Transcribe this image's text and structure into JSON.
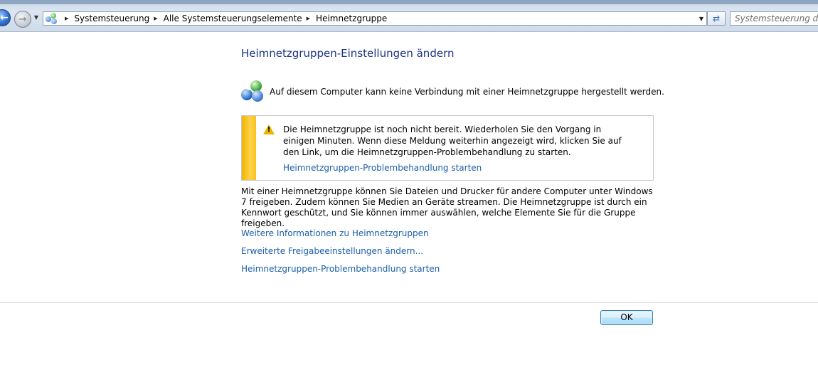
{
  "address_bar": {
    "breadcrumbs": [
      "Systemsteuerung",
      "Alle Systemsteuerungselemente",
      "Heimnetzgruppe"
    ],
    "search_placeholder": "Systemsteuerung durchsuchen"
  },
  "page": {
    "title": "Heimnetzgruppen-Einstellungen ändern",
    "status_message": "Auf diesem Computer kann keine Verbindung mit einer Heimnetzgruppe hergestellt werden."
  },
  "warning": {
    "text": "Die Heimnetzgruppe ist noch nicht bereit. Wiederholen Sie den Vorgang in einigen Minuten. Wenn diese Meldung weiterhin angezeigt wird, klicken Sie auf den Link, um die Heimnetzgruppen-Problembehandlung zu starten.",
    "link": "Heimnetzgruppen-Problembehandlung starten"
  },
  "description": "Mit einer Heimnetzgruppe können Sie Dateien und Drucker für andere Computer unter Windows 7 freigeben. Zudem können Sie Medien an Geräte streamen. Die Heimnetzgruppe ist durch ein Kennwort geschützt, und Sie können immer auswählen, welche Elemente Sie für die Gruppe freigeben.",
  "links": [
    "Weitere Informationen zu Heimnetzgruppen",
    "Erweiterte Freigabeeinstellungen ändern...",
    "Heimnetzgruppen-Problembehandlung starten"
  ],
  "buttons": {
    "ok": "OK"
  },
  "icons": {
    "back": "back-arrow-icon",
    "forward": "forward-arrow-icon",
    "homegroup": "homegroup-icon",
    "warning": "warning-icon",
    "refresh": "refresh-icon"
  },
  "colors": {
    "title": "#1e3287",
    "link": "#1a5fa8",
    "warning_bar": "#f0b400"
  }
}
